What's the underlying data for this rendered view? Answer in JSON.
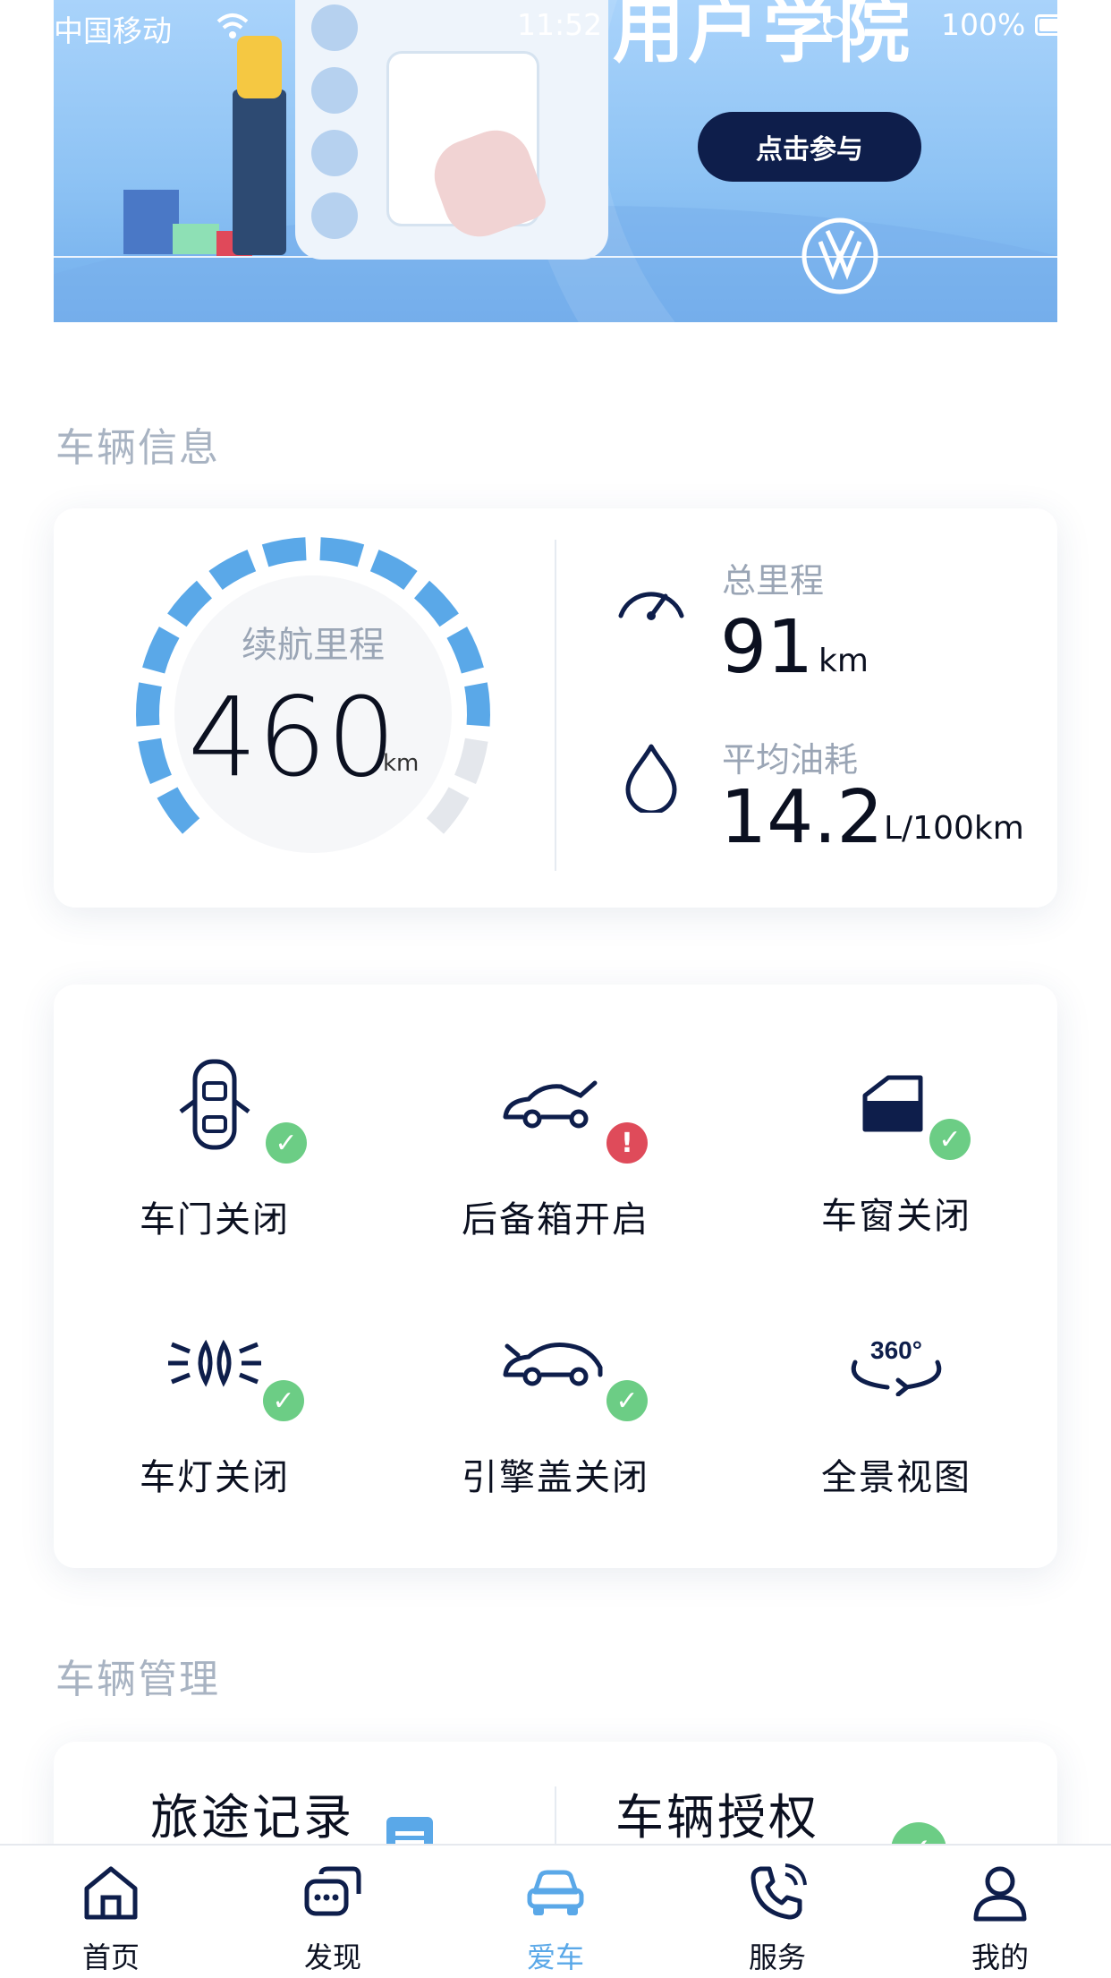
{
  "status_bar": {
    "carrier": "中国移动",
    "time": "11:52",
    "battery": "100%"
  },
  "banner": {
    "title": "用户学院",
    "cta": "点击参与"
  },
  "vehicle_info": {
    "section_title": "车辆信息",
    "range_label": "续航里程",
    "range_value": "460",
    "range_unit": "km",
    "range_fraction": 0.85,
    "total_mileage_label": "总里程",
    "total_mileage_value": "91",
    "total_mileage_unit": "km",
    "avg_fuel_label": "平均油耗",
    "avg_fuel_value": "14.2",
    "avg_fuel_unit": "L/100km"
  },
  "vehicle_status": {
    "items": [
      {
        "label": "车门关闭",
        "icon": "car-door-icon",
        "status": "ok"
      },
      {
        "label": "后备箱开启",
        "icon": "trunk-icon",
        "status": "alert"
      },
      {
        "label": "车窗关闭",
        "icon": "car-window-icon",
        "status": "ok"
      },
      {
        "label": "车灯关闭",
        "icon": "car-light-icon",
        "status": "ok"
      },
      {
        "label": "引擎盖关闭",
        "icon": "hood-icon",
        "status": "ok"
      },
      {
        "label": "全景视图",
        "icon": "360-view-icon",
        "status": "none"
      }
    ]
  },
  "vehicle_management": {
    "section_title": "车辆管理",
    "items": [
      {
        "label": "旅途记录",
        "icon": "trip-record-icon"
      },
      {
        "label": "车辆授权",
        "icon": "authorization-icon"
      }
    ]
  },
  "tabbar": {
    "tabs": [
      {
        "label": "首页",
        "icon": "home-icon"
      },
      {
        "label": "发现",
        "icon": "discover-icon"
      },
      {
        "label": "爱车",
        "icon": "car-icon",
        "active": true
      },
      {
        "label": "服务",
        "icon": "phone-icon"
      },
      {
        "label": "我的",
        "icon": "person-icon"
      }
    ]
  },
  "colors": {
    "accent": "#5aa8e8",
    "navy": "#0e1e4b",
    "ok": "#6ccd85",
    "alert": "#df4b5a"
  }
}
